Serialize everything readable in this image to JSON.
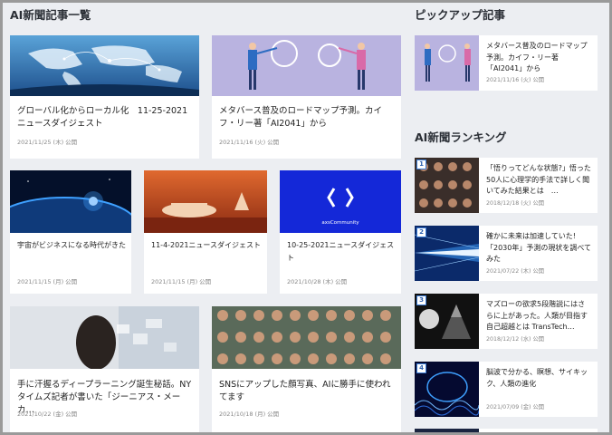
{
  "main": {
    "heading": "AI新聞記事一覧",
    "articles": [
      {
        "title": "グローバル化からローカル化　11-25-2021ニュースダイジェスト",
        "date": "2021/11/25 (木) 公開"
      },
      {
        "title": "メタバース普及のロードマップ予測。カイフ・リー著「AI2041」から",
        "date": "2021/11/16 (火) 公開"
      },
      {
        "title": "宇宙がビジネスになる時代がきた",
        "date": "2021/11/15 (月) 公開"
      },
      {
        "title": "11-4-2021ニュースダイジェスト",
        "date": "2021/11/15 (月) 公開"
      },
      {
        "title": "10-25-2021ニュースダイジェスト",
        "date": "2021/10/28 (木) 公開",
        "thumb_text": "axsCommunity"
      },
      {
        "title": "手に汗握るディープラーニング誕生秘話。NYタイムズ記者が書いた「ジーニアス・メーカ…",
        "date": "2021/10/22 (金) 公開"
      },
      {
        "title": "SNSにアップした顔写真、AIに勝手に使われてます",
        "date": "2021/10/18 (月) 公開"
      }
    ]
  },
  "sidebar": {
    "pickup_heading": "ピックアップ記事",
    "pickup": [
      {
        "title": "メタバース普及のロードマップ予測。カイフ・リー著「AI2041」から",
        "date": "2021/11/16 (火) 公開"
      }
    ],
    "ranking_heading": "AI新聞ランキング",
    "ranking": [
      {
        "rank": "1",
        "title": "「悟りってどんな状態?」悟った50人に心理学的手法で詳しく聞いてみた結果とは　…",
        "date": "2018/12/18 (火) 公開"
      },
      {
        "rank": "2",
        "title": "確かに未来は加速していた!「2030年」予測の現状を調べてみた",
        "date": "2021/07/22 (木) 公開"
      },
      {
        "rank": "3",
        "title": "マズローの欲求5段階説にはさらに上があった。人類が目指す自己超越とは TransTech…",
        "date": "2018/12/12 (水) 公開"
      },
      {
        "rank": "4",
        "title": "脳波で分かる、瞑想、サイキック、人類の進化",
        "date": "2021/07/09 (金) 公開"
      }
    ]
  },
  "colors": {
    "accent": "#3a7bd5",
    "background": "#eceef2"
  }
}
